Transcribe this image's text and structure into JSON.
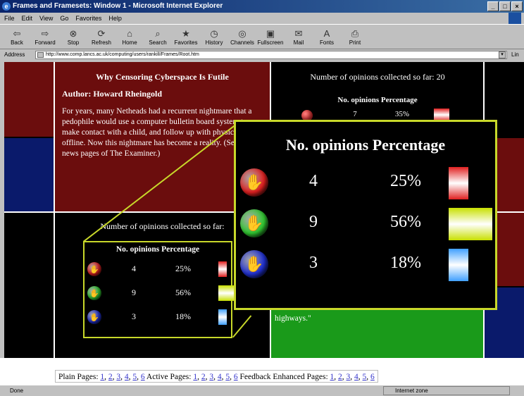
{
  "window": {
    "title": "Frames and Framesets: Window 1 - Microsoft Internet Explorer"
  },
  "menubar": [
    "File",
    "Edit",
    "View",
    "Go",
    "Favorites",
    "Help"
  ],
  "toolbar": [
    {
      "label": "Back",
      "icon": "back-arrow-icon",
      "glyph": "⇦"
    },
    {
      "label": "Forward",
      "icon": "forward-arrow-icon",
      "glyph": "⇨"
    },
    {
      "label": "Stop",
      "icon": "stop-icon",
      "glyph": "⊗"
    },
    {
      "label": "Refresh",
      "icon": "refresh-icon",
      "glyph": "⟳"
    },
    {
      "label": "Home",
      "icon": "home-icon",
      "glyph": "⌂"
    },
    {
      "label": "Search",
      "icon": "search-icon",
      "glyph": "⌕"
    },
    {
      "label": "Favorites",
      "icon": "favorites-icon",
      "glyph": "★"
    },
    {
      "label": "History",
      "icon": "history-icon",
      "glyph": "◷"
    },
    {
      "label": "Channels",
      "icon": "channels-icon",
      "glyph": "◎"
    },
    {
      "label": "Fullscreen",
      "icon": "fullscreen-icon",
      "glyph": "▣"
    },
    {
      "label": "Mail",
      "icon": "mail-icon",
      "glyph": "✉"
    },
    {
      "label": "Fonts",
      "icon": "fonts-icon",
      "glyph": "A"
    },
    {
      "label": "Print",
      "icon": "print-icon",
      "glyph": "⎙"
    }
  ],
  "address": {
    "label": "Address",
    "url": "http://www.comp.lancs.ac.uk/computing/users/rankill/Frames/Root.htm",
    "links": "Lin"
  },
  "article": {
    "title": "Why Censoring Cyberspace Is Futile",
    "author": "Author: Howard Rheingold",
    "body": "For years, many Netheads had a recurrent nightmare that a pedophile would use a computer bulletin board system to make contact with a child, and follow up with physical abuse offline. Now this nightmare has become a reality. (See the news pages of The Examiner.)",
    "fragment": "highways.\""
  },
  "opinions": {
    "count_label": "Number of opinions collected so far: 20",
    "count_label_partial": "Number of opinions collected so far:",
    "col_count": "No. opinions",
    "col_percent": "Percentage",
    "rows": [
      {
        "count": "4",
        "percent": "25%",
        "ball_color": "#e02020",
        "bar_color": "#e02020",
        "icon": "red-opinion-ball-icon",
        "share": 0.25
      },
      {
        "count": "9",
        "percent": "56%",
        "ball_color": "#30c830",
        "bar_color": "#c8e000",
        "icon": "green-opinion-ball-icon",
        "share": 0.56
      },
      {
        "count": "3",
        "percent": "18%",
        "ball_color": "#2030d0",
        "bar_color": "#40a0ff",
        "icon": "blue-opinion-ball-icon",
        "share": 0.18
      }
    ],
    "partial_row": {
      "count": "7",
      "percent": "35%"
    }
  },
  "page_links": {
    "plain_label": "Plain Pages:",
    "active_label": "Active Pages:",
    "feedback_label": "Feedback Enhanced Pages:",
    "numbers": [
      "1",
      "2",
      "3",
      "4",
      "5",
      "6"
    ]
  },
  "status": {
    "text": "Done",
    "zone": "Internet zone"
  }
}
